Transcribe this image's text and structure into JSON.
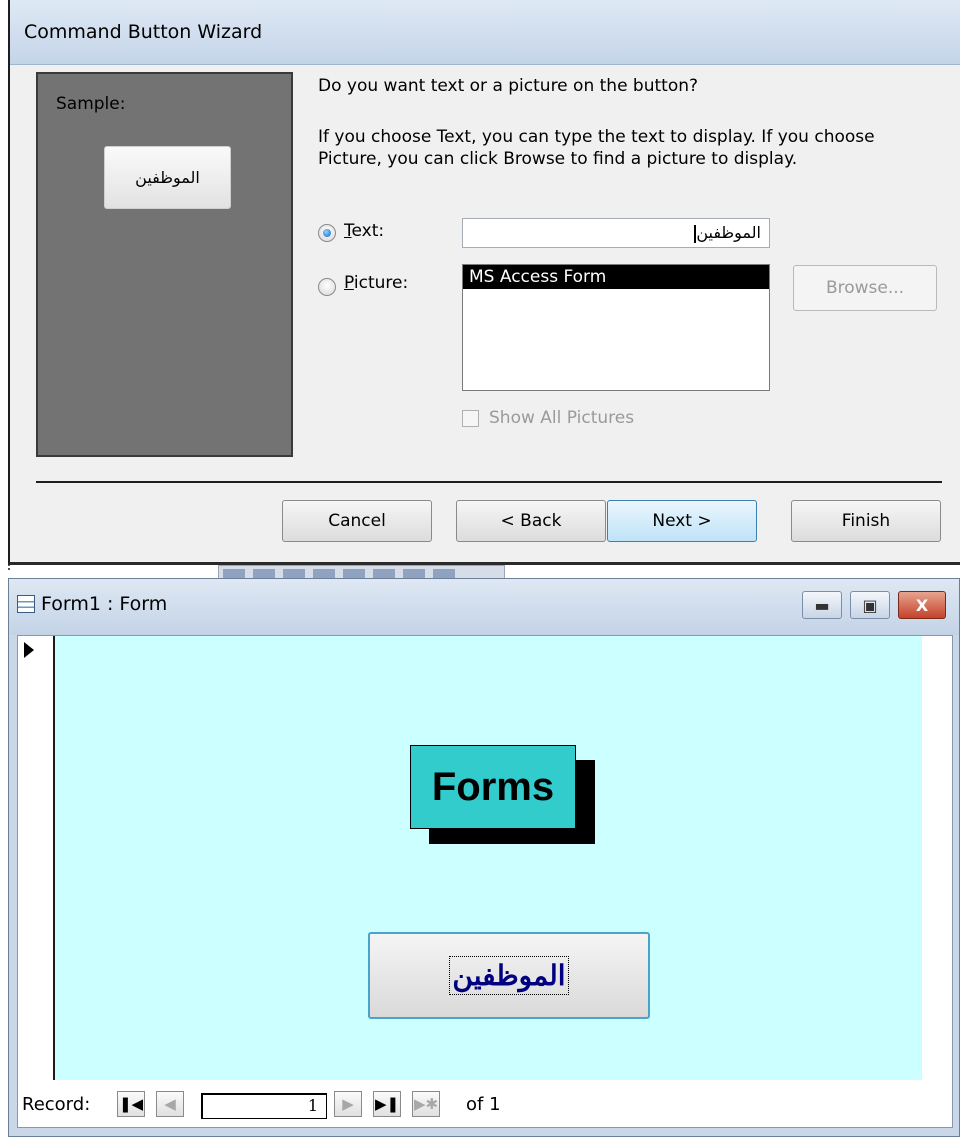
{
  "wizard": {
    "title": "Command Button Wizard",
    "sample_label": "Sample:",
    "sample_button_text": "الموظفين",
    "question": "Do you want text or a picture on the button?",
    "info": "If you choose Text, you can type the text to display.  If you choose Picture, you can click Browse to find a picture to display.",
    "text_option": {
      "mnemonic": "T",
      "rest": "ext:",
      "selected": true
    },
    "text_value": "الموظفين",
    "picture_option": {
      "mnemonic": "P",
      "rest": "icture:",
      "selected": false
    },
    "picture_list": [
      "MS Access Form"
    ],
    "browse_label": "Browse...",
    "show_all_label": "Show All Pictures",
    "buttons": {
      "cancel": "Cancel",
      "back": "< Back",
      "next": "Next >",
      "finish": "Finish"
    }
  },
  "form_window": {
    "title": "Form1 : Form",
    "minimize_icon": "minimize-icon",
    "restore_icon": "restore-icon",
    "close_icon": "close-icon",
    "label_text": "Forms",
    "button_text": "الموظفين",
    "nav": {
      "record_label": "Record:",
      "current": "1",
      "of_label": "of 1"
    }
  },
  "colors": {
    "detail_background": "#ccffff",
    "label_background": "#33cccc",
    "button_text_color": "#000080",
    "sample_panel": "#737373"
  }
}
